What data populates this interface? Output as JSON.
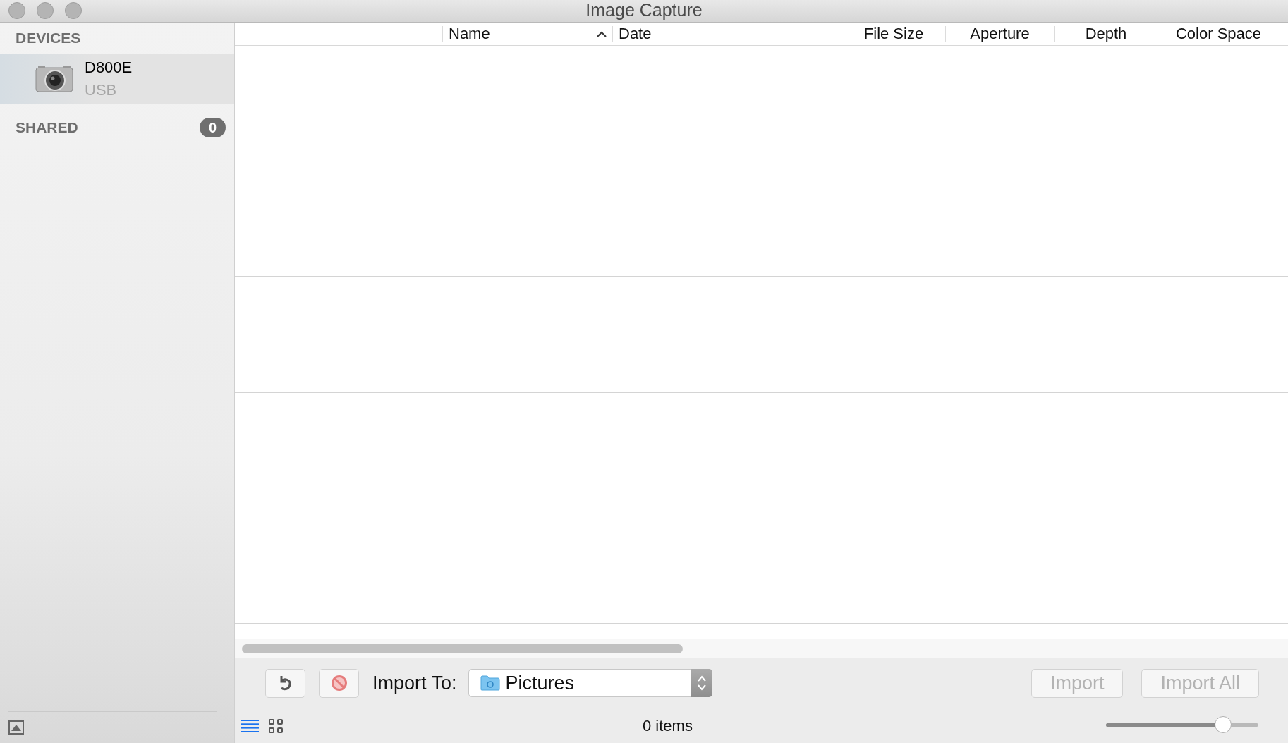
{
  "window": {
    "title": "Image Capture"
  },
  "sidebar": {
    "sections": [
      {
        "title": "DEVICES",
        "items": [
          {
            "name": "D800E",
            "subtitle": "USB",
            "selected": true
          }
        ]
      },
      {
        "title": "SHARED",
        "count": "0"
      }
    ]
  },
  "table": {
    "columns": [
      {
        "sorted": false
      },
      {
        "label": "Name",
        "sorted": true
      },
      {
        "label": "Date",
        "sorted": false
      },
      {
        "label": "File Size",
        "sorted": false
      },
      {
        "label": "Aperture",
        "sorted": false
      },
      {
        "label": "Depth",
        "sorted": false
      },
      {
        "label": "Color Space",
        "sorted": false
      }
    ]
  },
  "toolbar": {
    "import_to_label": "Import To:",
    "destination": "Pictures",
    "buttons": [
      {
        "label": "Import",
        "disabled": true
      },
      {
        "label": "Import All",
        "disabled": true
      }
    ]
  },
  "status_bar": {
    "view_modes": [
      {
        "kind": "list",
        "selected": true
      },
      {
        "kind": "grid",
        "selected": false
      }
    ],
    "item_count": "0 items",
    "thumbnail_size": {
      "level": 0.77
    }
  }
}
